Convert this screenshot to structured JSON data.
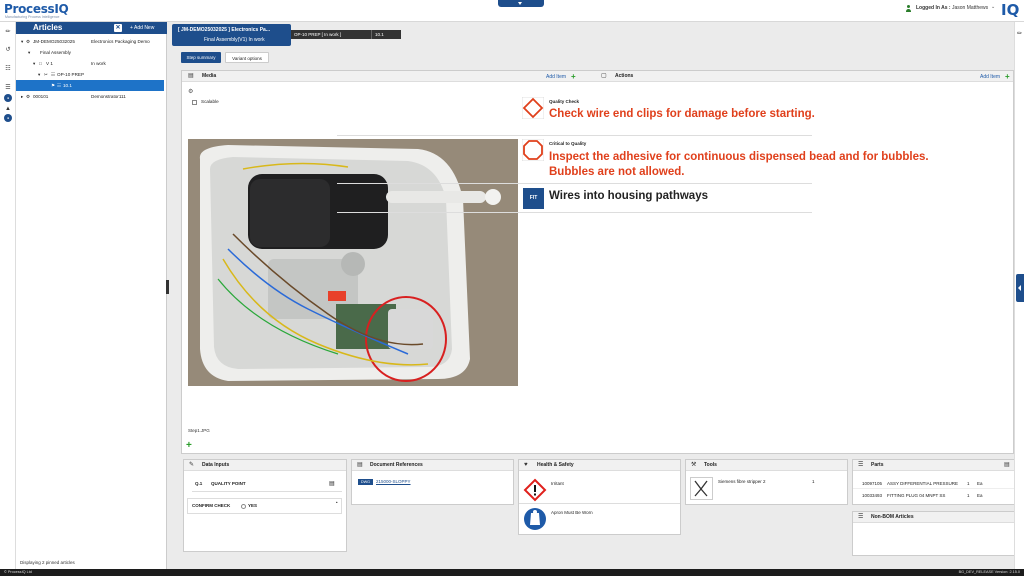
{
  "app": {
    "logo": "ProcessIQ",
    "logo_tagline": "Manufacturing Process Intelligence",
    "logo_right": "IQ"
  },
  "user": {
    "logged_label": "Logged In As :",
    "name": "Jason Matthews"
  },
  "articles": {
    "title": "Articles",
    "add_label": "+ Add New",
    "tree": [
      {
        "label": "JM-DEMO25032025",
        "value": "Electronics Packaging Demo",
        "indent": 0
      },
      {
        "label": "Final Assembly",
        "value": "",
        "indent": 1
      },
      {
        "label": "V 1",
        "value": "In work",
        "indent": 2
      },
      {
        "label": "OP-10 PREP",
        "value": "",
        "indent": 3
      },
      {
        "label": "10.1",
        "value": "",
        "indent": 4,
        "selected": true
      },
      {
        "label": "000101",
        "value": "Demonstrator111",
        "indent": 0
      }
    ],
    "footer": "Displaying 2 pinned articles"
  },
  "breadcrumb": {
    "main_line1": "[ JM-DEMO25032025 ]   Electronics Pa...",
    "main_line2": "Final Assembly(V1) In work",
    "op": "OP-10 PREP [ In work ]",
    "step": "10.1"
  },
  "tabs": [
    {
      "label": "Step summary",
      "active": true
    },
    {
      "label": "Variant options",
      "active": false
    }
  ],
  "media": {
    "title": "Media",
    "add_label": "Add Item",
    "scalable_label": "Scalable",
    "image_caption": "Step1.JPG"
  },
  "actions": {
    "title": "Actions",
    "add_label": "Add Item",
    "items": [
      {
        "category": "Quality Check",
        "text": "Check wire end clips for damage before starting.",
        "color": "#e0401c",
        "icon": "quality-check-icon"
      },
      {
        "category": "Critical to Quality",
        "text": "Inspect the adhesive for continuous dispensed bead and for bubbles.",
        "text2": "Bubbles are not allowed.",
        "color": "#e0401c",
        "icon": "critical-quality-icon"
      },
      {
        "category": "",
        "text": "Wires into housing pathways",
        "color": "#222222",
        "icon": "fit-icon",
        "icon_label": "FIT"
      }
    ]
  },
  "data_inputs": {
    "title": "Data Inputs",
    "rows": [
      {
        "id": "Q.1",
        "label": "QUALITY POINT"
      },
      {
        "id": "",
        "label": "CONFIRM CHECK",
        "option": "YES"
      }
    ]
  },
  "doc_refs": {
    "title": "Document References",
    "badge": "DWG",
    "link": "215000-SLOPPY"
  },
  "health_safety": {
    "title": "Health & Safety",
    "items": [
      {
        "label": "Irritant",
        "icon": "irritant-icon"
      },
      {
        "label": "Apron Must Be Worn",
        "icon": "apron-icon"
      }
    ]
  },
  "tools": {
    "title": "Tools",
    "items": [
      {
        "name": "Siemens fibre stripper 2",
        "qty": "1"
      }
    ]
  },
  "parts": {
    "title": "Parts",
    "items": [
      {
        "number": "10097105",
        "name": "ASSY DIFFERENTIAL PRESSURE",
        "qty": "1",
        "unit": "Ea"
      },
      {
        "number": "10033493",
        "name": "FITTING PLUG 04 MNPT SS",
        "qty": "1",
        "unit": "Ea"
      }
    ]
  },
  "non_bom": {
    "title": "Non-BOM Articles"
  },
  "footer": {
    "left": "© ProcessIQ Ltd",
    "right": "BG_DEV_RELEASE   Version: 2.15.0"
  },
  "colors": {
    "primary": "#1e4e8c",
    "selected": "#1e73c8",
    "alert": "#e0401c",
    "add_green": "#2a9d2a"
  }
}
